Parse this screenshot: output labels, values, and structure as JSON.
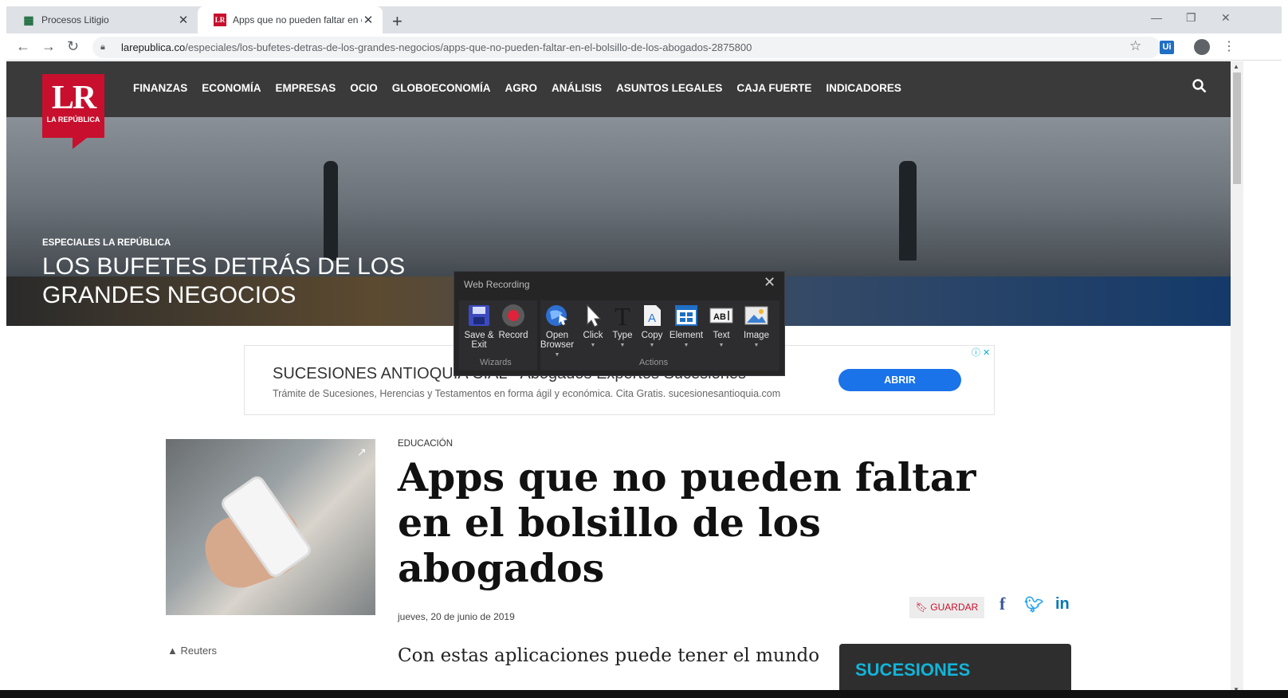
{
  "browser": {
    "tabs": [
      {
        "label": "Procesos Litigio",
        "active": false
      },
      {
        "label": "Apps que no pueden faltar en el",
        "active": true
      }
    ],
    "new_tab": "+",
    "url_domain": "larepublica.co",
    "url_path": "/especiales/los-bufetes-detras-de-los-grandes-negocios/apps-que-no-pueden-faltar-en-el-bolsillo-de-los-abogados-2875800",
    "extension_label": "Ui"
  },
  "site": {
    "logo_big": "LR",
    "logo_small": "LA REPÚBLICA",
    "menu": [
      "FINANZAS",
      "ECONOMÍA",
      "EMPRESAS",
      "OCIO",
      "GLOBOECONOMÍA",
      "AGRO",
      "ANÁLISIS",
      "ASUNTOS LEGALES",
      "CAJA FUERTE",
      "INDICADORES"
    ],
    "hero_kicker": "ESPECIALES LA REPÚBLICA",
    "hero_headline": "LOS BUFETES DETRÁS DE LOS GRANDES NEGOCIOS"
  },
  "ad": {
    "title": "SUCESIONES ANTIOQUIA CIAL - Abogados Expertos Sucesiones",
    "text": "Trámite de Sucesiones, Herencias y Testamentos en forma ágil y económica. Cita Gratis. sucesionesantioquia.com",
    "button": "ABRIR"
  },
  "article": {
    "category": "EDUCACIÓN",
    "title": "Apps que no pueden faltar en el bolsillo de los abogados",
    "date": "jueves, 20 de junio de 2019",
    "save_label": "GUARDAR",
    "photo_credit": "Reuters",
    "lead": "Con estas aplicaciones puede tener el mundo",
    "side_title": "SUCESIONES"
  },
  "recorder": {
    "title": "Web Recording",
    "wizards": {
      "label": "Wizards",
      "buttons": [
        {
          "label": "Save & Exit",
          "icon": "save-icon"
        },
        {
          "label": "Record",
          "icon": "record-icon"
        }
      ]
    },
    "actions": {
      "label": "Actions",
      "buttons": [
        {
          "label": "Open Browser",
          "icon": "globe-icon"
        },
        {
          "label": "Click",
          "icon": "cursor-icon"
        },
        {
          "label": "Type",
          "icon": "type-icon"
        },
        {
          "label": "Copy",
          "icon": "copy-icon"
        },
        {
          "label": "Element",
          "icon": "element-icon"
        },
        {
          "label": "Text",
          "icon": "text-icon"
        },
        {
          "label": "Image",
          "icon": "image-icon"
        }
      ]
    }
  },
  "colors": {
    "brand": "#c8102e",
    "nav_bg": "#3a3a3a",
    "ad_button": "#1a73e8",
    "recorder_bg": "#252526"
  }
}
